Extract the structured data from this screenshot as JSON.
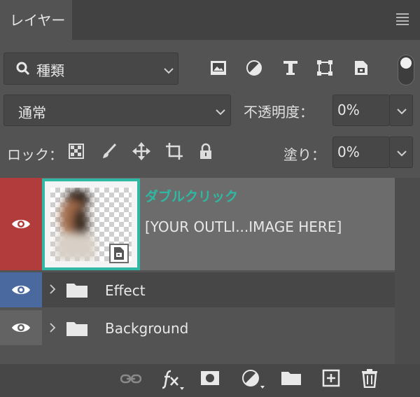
{
  "tab": {
    "label": "レイヤー"
  },
  "filter": {
    "search_icon": "magnifier-icon",
    "kind_label": "種類"
  },
  "blend": {
    "mode": "通常"
  },
  "opacity": {
    "label": "不透明度：",
    "value": "0%"
  },
  "lock": {
    "label": "ロック："
  },
  "fill": {
    "label": "塗り：",
    "value": "0%"
  },
  "layers": [
    {
      "name": "[YOUR OUTLI...IMAGE HERE]",
      "annotation": "ダブルクリック",
      "selected": true
    },
    {
      "name": "Effect",
      "type": "group"
    },
    {
      "name": "Background",
      "type": "group"
    }
  ],
  "colors": {
    "annotation": "#2fb8a3",
    "eye_selected": "#b23b3b",
    "eye_effect": "#4a6a9f",
    "eye_background": "#636363"
  }
}
